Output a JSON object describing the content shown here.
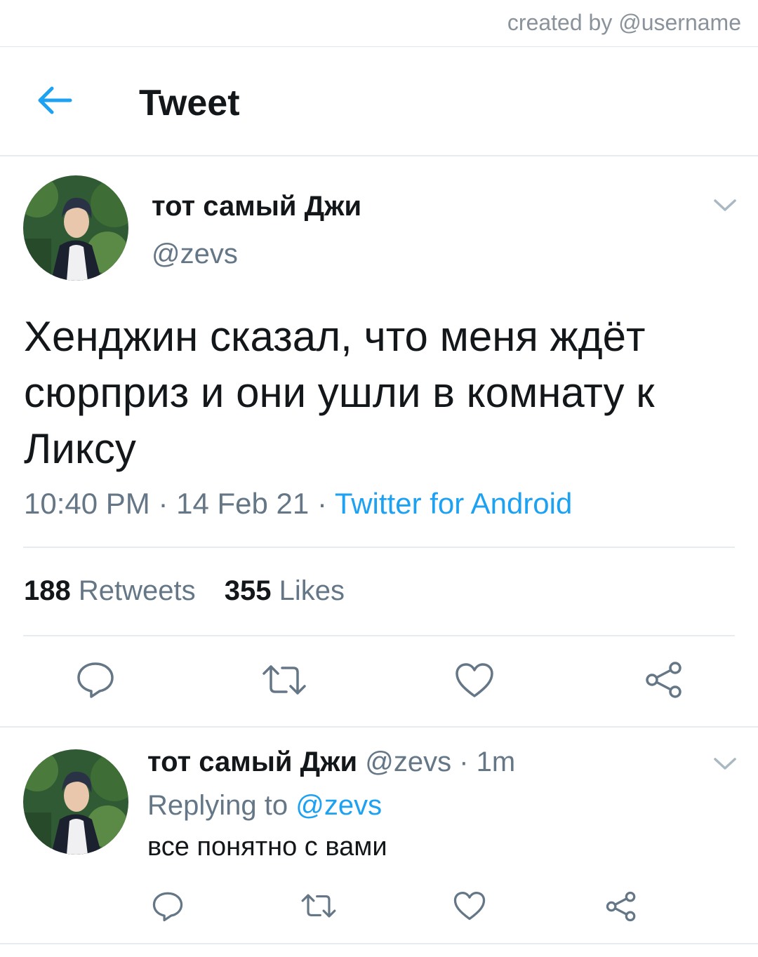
{
  "watermark": "created by @username",
  "header": {
    "title": "Tweet",
    "back_icon": "arrow-left-icon"
  },
  "colors": {
    "accent": "#1da1f2",
    "text": "#14171a",
    "muted": "#657786",
    "divider": "#e6ecf0"
  },
  "tweet": {
    "display_name": "тот самый Джи",
    "handle": "@zevs",
    "text": "Хенджин сказал, что меня ждёт сюрприз и они ушли в комнату к Ликсу",
    "time": "10:40 PM",
    "date": "14 Feb 21",
    "separator": "·",
    "source": "Twitter for Android",
    "retweets_count": "188",
    "retweets_label": "Retweets",
    "likes_count": "355",
    "likes_label": "Likes",
    "actions": [
      "reply-icon",
      "retweet-icon",
      "like-heart-icon",
      "share-icon"
    ]
  },
  "reply": {
    "display_name": "тот самый Джи",
    "handle": "@zevs",
    "separator": "·",
    "age": "1m",
    "replying_prefix": "Replying to",
    "replying_to": "@zevs",
    "text": "все понятно с вами",
    "actions": [
      "reply-icon",
      "retweet-icon",
      "like-heart-icon",
      "share-icon"
    ]
  }
}
